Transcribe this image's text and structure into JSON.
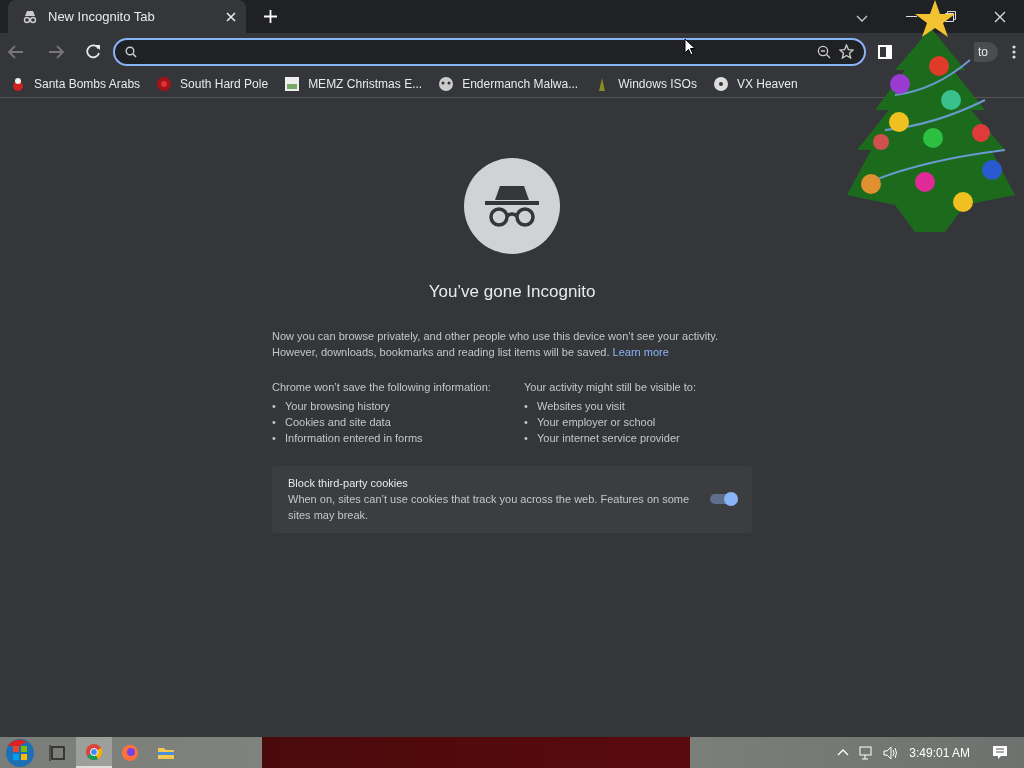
{
  "tab": {
    "title": "New Incognito Tab",
    "selected": true
  },
  "toolbar": {
    "profile_label": "to"
  },
  "bookmarks": [
    {
      "label": "Santa Bombs Arabs",
      "kind": "santa"
    },
    {
      "label": "South Hard Pole",
      "kind": "ball"
    },
    {
      "label": "MEMZ Christmas E...",
      "kind": "page"
    },
    {
      "label": "Endermanch Malwa...",
      "kind": "face"
    },
    {
      "label": "Windows ISOs",
      "kind": "tower"
    },
    {
      "label": "VX Heaven",
      "kind": "disk"
    }
  ],
  "content": {
    "heading": "You’ve gone Incognito",
    "intro": "Now you can browse privately, and other people who use this device won’t see your activity. However, downloads, bookmarks and reading list items will be saved.",
    "learn_more": "Learn more",
    "columns": [
      {
        "title": "Chrome won’t save the following information:",
        "bullet": "•",
        "items": [
          "Your browsing history",
          "Cookies and site data",
          "Information entered in forms"
        ]
      },
      {
        "title": "Your activity might still be visible to:",
        "bullet": "•",
        "items": [
          "Websites you visit",
          "Your employer or school",
          "Your internet service provider"
        ]
      }
    ],
    "cookies": {
      "title": "Block third-party cookies",
      "description": "When on, sites can’t use cookies that track you across the web. Features on some sites may break.",
      "on": true
    }
  },
  "taskbar": {
    "apps": [
      {
        "kind": "taskview",
        "selected": false
      },
      {
        "kind": "chrome",
        "selected": true
      },
      {
        "kind": "firefox",
        "selected": false
      },
      {
        "kind": "folder",
        "selected": false
      }
    ],
    "clock": "3:49:01 AM"
  }
}
